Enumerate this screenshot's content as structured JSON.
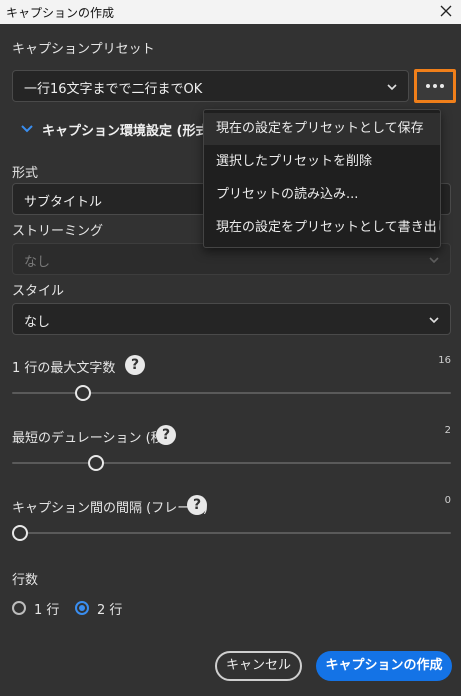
{
  "window": {
    "title": "キャプションの作成",
    "close_icon": "close-icon"
  },
  "preset": {
    "label": "キャプションプリセット",
    "selected": "一行16文字までで二行までOK",
    "more_icon": "ellipsis-icon"
  },
  "section": {
    "title": "キャプション環境設定 (形式、"
  },
  "format": {
    "label": "形式",
    "selected": "サブタイトル"
  },
  "streaming": {
    "label": "ストリーミング",
    "selected": "なし"
  },
  "style": {
    "label": "スタイル",
    "selected": "なし"
  },
  "max_chars": {
    "label": "1 行の最大文字数",
    "value_text": "16",
    "fraction": 0.15
  },
  "min_duration": {
    "label": "最短のデュレーション (秒)",
    "value_text": "2",
    "fraction": 0.18
  },
  "gap": {
    "label": "キャプション間の間隔 (フレーム)",
    "value_text": "0",
    "fraction": 0.0
  },
  "lines": {
    "label": "行数",
    "options": [
      {
        "label": "1 行",
        "selected": false
      },
      {
        "label": "2 行",
        "selected": true
      }
    ]
  },
  "buttons": {
    "cancel": "キャンセル",
    "create": "キャプションの作成"
  },
  "menu": {
    "items": [
      "現在の設定をプリセットとして保存",
      "選択したプリセットを削除",
      "プリセットの読み込み...",
      "現在の設定をプリセットとして書き出し..."
    ]
  },
  "colors": {
    "accent": "#1473e6",
    "highlight": "#f07f1a",
    "background": "#323232"
  }
}
